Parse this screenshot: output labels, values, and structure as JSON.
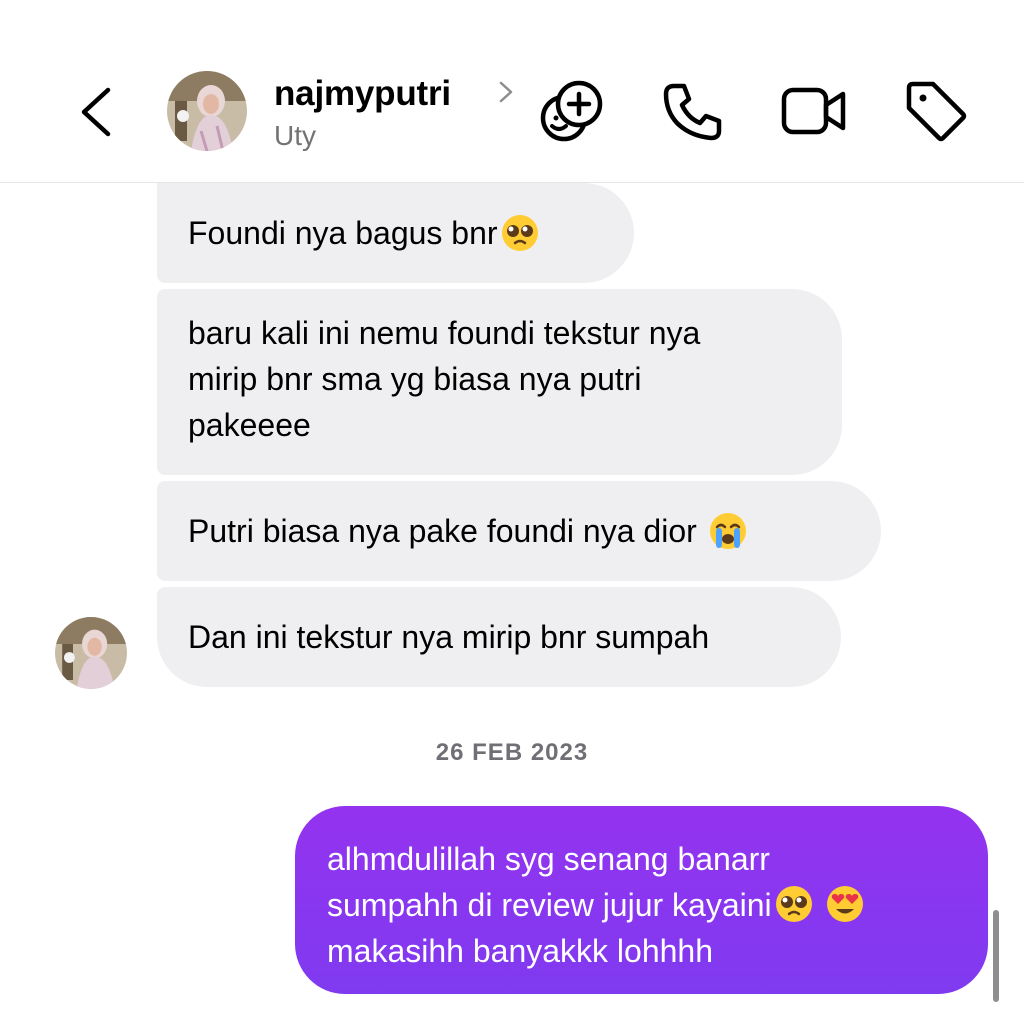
{
  "header": {
    "username": "najmyputri",
    "subname": "Uty",
    "icons": {
      "back": "chevron-left-icon",
      "profile_arrow": "chevron-right-icon",
      "add_people": "add-people-icon",
      "call": "phone-icon",
      "video": "video-icon",
      "tag": "tag-icon"
    }
  },
  "messages": {
    "received": [
      {
        "text": "Foundi nya bagus bnr",
        "emoji": "pleading-face"
      },
      {
        "text": "baru kali ini nemu foundi tekstur nya\nmirip bnr sma yg biasa nya putri\npakeeee"
      },
      {
        "text": "Putri biasa nya pake foundi nya dior ",
        "emoji": "crying-face"
      },
      {
        "text": "Dan ini tekstur nya mirip bnr sumpah"
      }
    ],
    "date_separator": "26 FEB 2023",
    "sent": {
      "line1": "alhmdulillah syg senang banarr",
      "line2": "sumpahh di review jujur kayaini",
      "line3": "makasihh banyakkk lohhhh",
      "emojis": [
        "pleading-face",
        "heart-eyes-face"
      ]
    }
  },
  "colors": {
    "sent_bubble": "#8a36f0",
    "received_bubble": "#efeff1",
    "secondary_text": "#737373"
  }
}
